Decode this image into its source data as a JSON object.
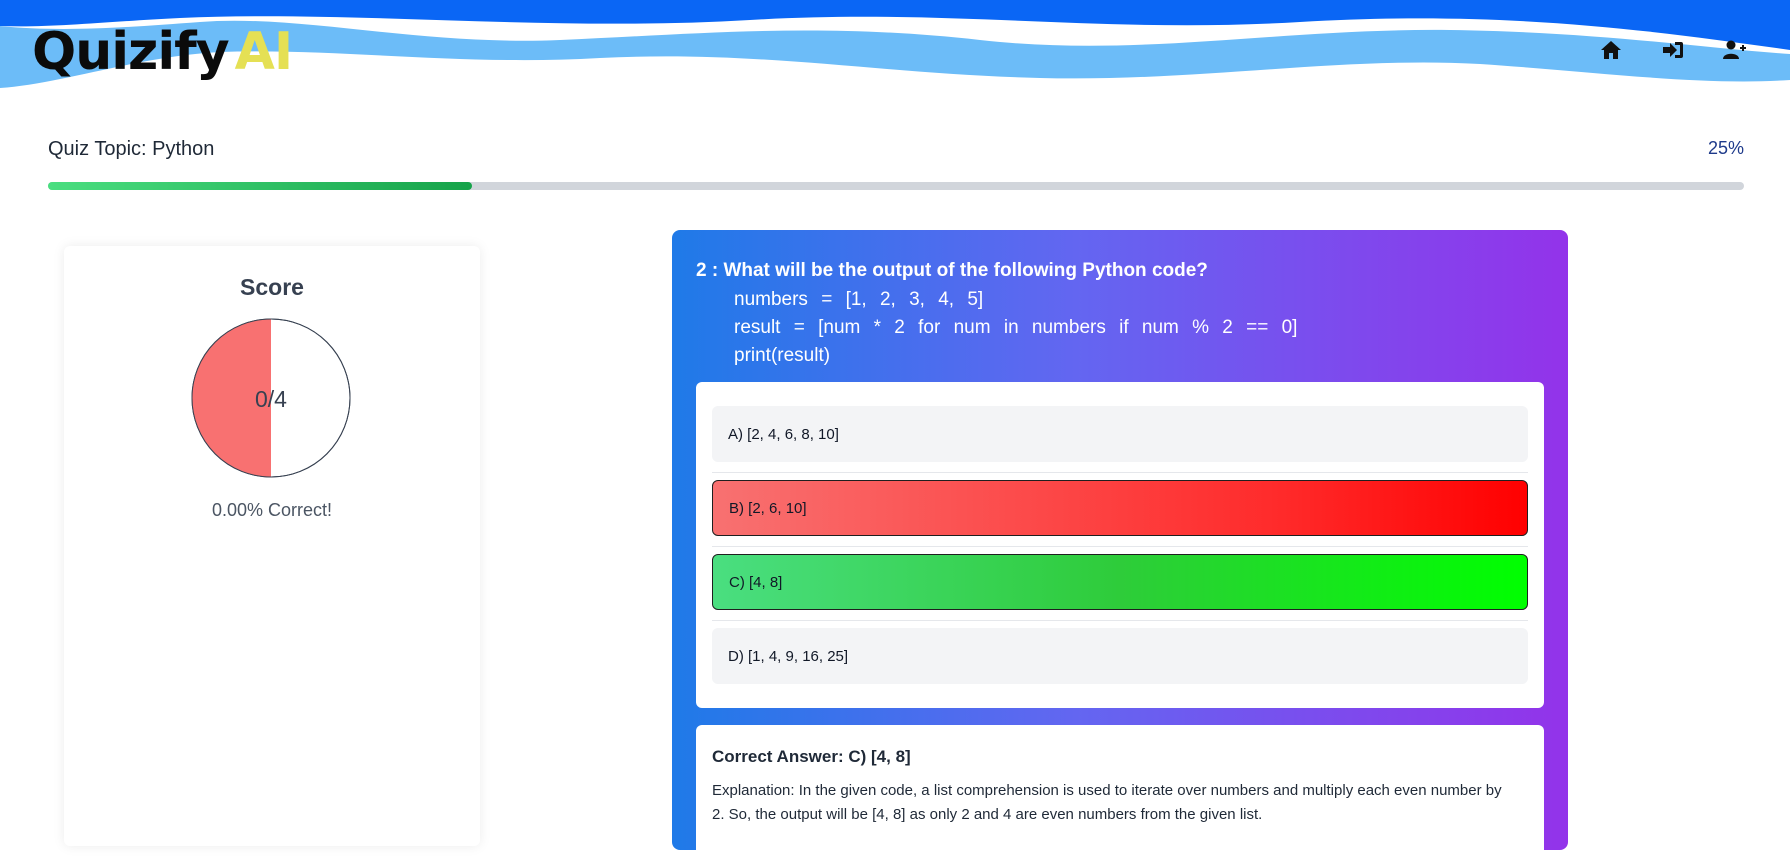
{
  "header": {
    "logo_main": "Quizify",
    "logo_accent": "AI",
    "nav": [
      {
        "icon": "home-icon"
      },
      {
        "icon": "sign-in-icon"
      },
      {
        "icon": "user-plus-icon"
      }
    ]
  },
  "quiz": {
    "topic_label": "Quiz Topic: Python",
    "progress_label": "25%",
    "progress_value": 0.25
  },
  "score": {
    "title": "Score",
    "value": "0/4",
    "correct_fraction": 0.5,
    "percent_text": "0.00% Correct!"
  },
  "question": {
    "title": "2 : What will be the output of the following Python code?",
    "code": [
      "numbers = [1, 2, 3, 4, 5]",
      "result = [num * 2 for num in numbers if num % 2 == 0]",
      "print(result)"
    ],
    "options": [
      {
        "label": "A) [2, 4, 6, 8, 10]",
        "state": "neutral"
      },
      {
        "label": "B) [2, 6, 10]",
        "state": "wrong"
      },
      {
        "label": "C) [4, 8]",
        "state": "right"
      },
      {
        "label": "D) [1, 4, 9, 16, 25]",
        "state": "neutral"
      }
    ]
  },
  "answer": {
    "title": "Correct Answer: C) [4, 8]",
    "explanation": "Explanation: In the given code, a list comprehension is used to iterate over numbers and multiply each even number by 2. So, the output will be [4, 8] as only 2 and 4 are even numbers from the given list."
  },
  "colors": {
    "accent": "#e5e054",
    "wrong": "#ff0000",
    "right": "#00ff00",
    "pie_fill": "#f87171"
  }
}
